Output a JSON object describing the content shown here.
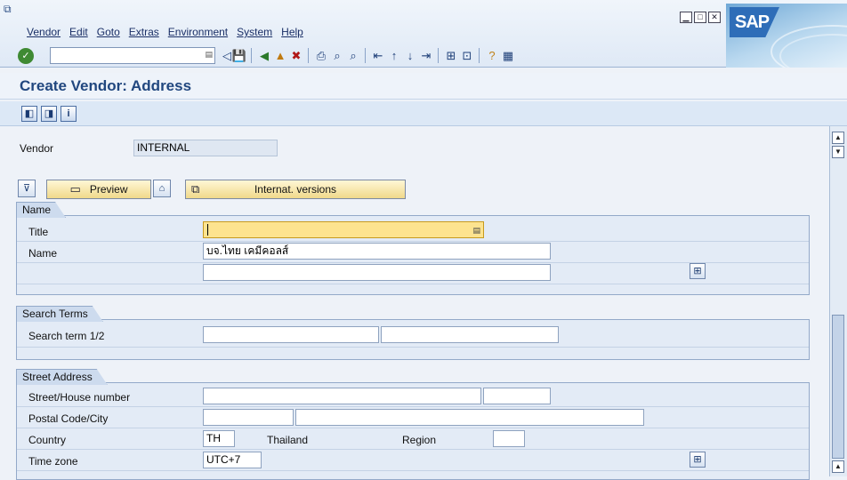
{
  "menu": [
    "Vendor",
    "Edit",
    "Goto",
    "Extras",
    "Environment",
    "System",
    "Help"
  ],
  "logo_text": "SAP",
  "toolbar": {
    "command_field": "",
    "icons": [
      "back-icon",
      "save-icon",
      "nav-back-icon",
      "exit-icon",
      "cancel-icon",
      "print-icon",
      "find-icon",
      "find-next-icon",
      "first-page-icon",
      "prev-page-icon",
      "next-page-icon",
      "last-page-icon",
      "new-session-icon",
      "shortcut-icon",
      "help-icon",
      "layout-icon"
    ]
  },
  "page_title": "Create Vendor: Address",
  "vendor": {
    "label": "Vendor",
    "value": "INTERNAL"
  },
  "buttons": {
    "preview": "Preview",
    "internat": "Internat. versions"
  },
  "name_group": {
    "title": "Name",
    "title_label": "Title",
    "title_value": "",
    "name_label": "Name",
    "name_value": "บจ.ไทย เคมีคอลส์",
    "name2_value": ""
  },
  "search_group": {
    "title": "Search Terms",
    "label": "Search term 1/2",
    "value1": "",
    "value2": ""
  },
  "street_group": {
    "title": "Street Address",
    "street_label": "Street/House number",
    "street_value": "",
    "house_value": "",
    "postal_label": "Postal Code/City",
    "postal_value": "",
    "city_value": "",
    "country_label": "Country",
    "country_value": "TH",
    "country_name": "Thailand",
    "region_label": "Region",
    "region_value": "",
    "timezone_label": "Time zone",
    "timezone_value": "UTC+7"
  }
}
